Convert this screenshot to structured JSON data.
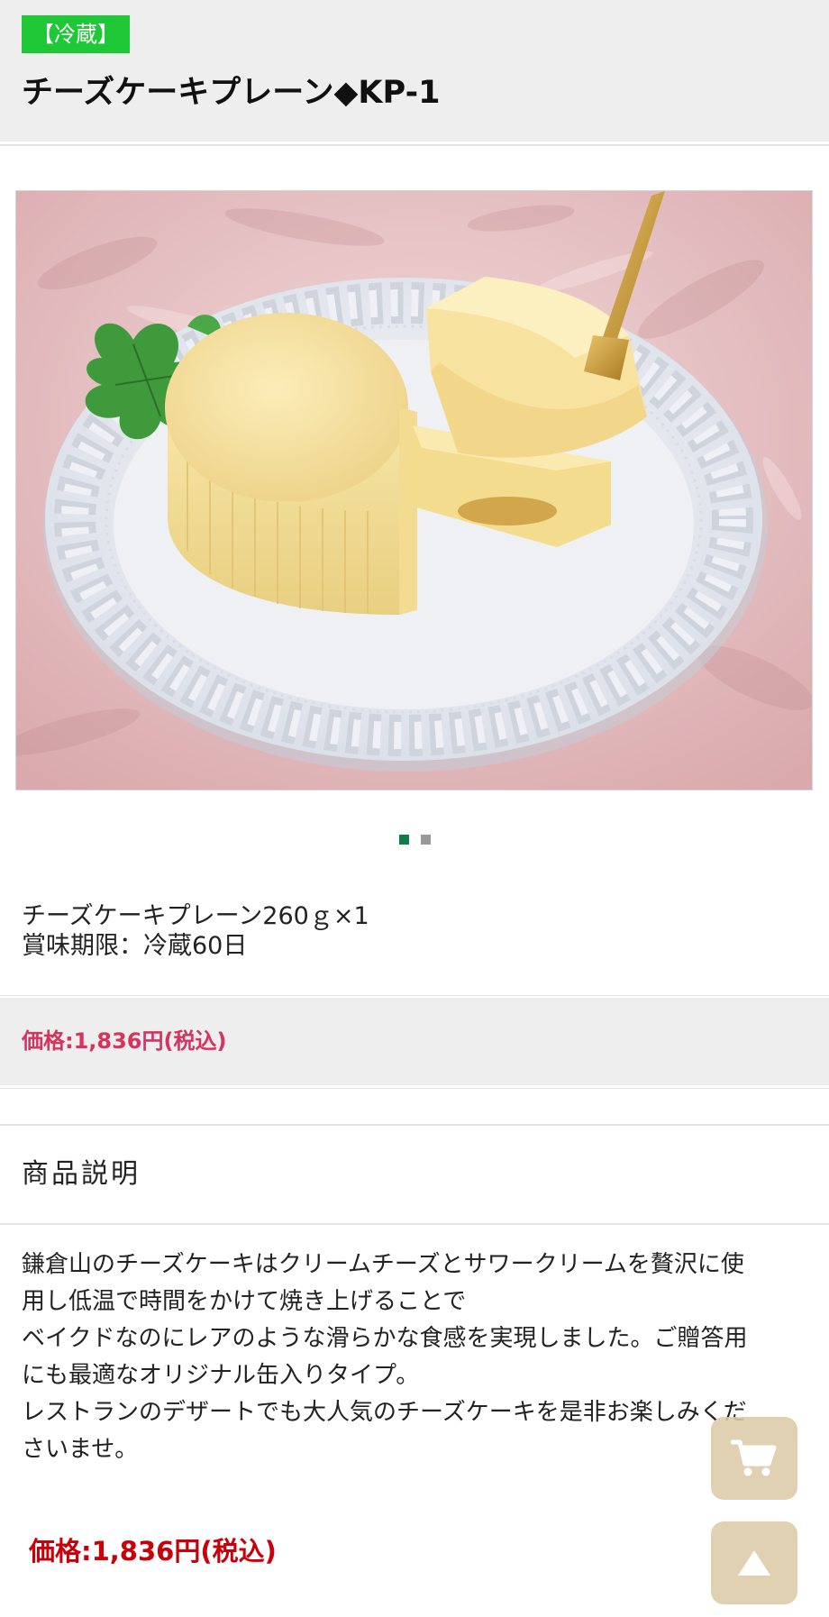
{
  "header": {
    "tag": "【冷蔵】",
    "title": "チーズケーキプレーン◆KP-1"
  },
  "gallery": {
    "image_name": "cheesecake-photo",
    "total_slides": 2,
    "active_slide": 1
  },
  "specs": {
    "line1": "チーズケーキプレーン260ｇ×1",
    "line2": "賞味期限：冷蔵60日"
  },
  "price_band": {
    "text": "価格:1,836円(税込)"
  },
  "description": {
    "heading": "商品説明",
    "lines": [
      "鎌倉山のチーズケーキはクリームチーズとサワークリームを贅沢に使",
      "用し低温で時間をかけて焼き上げることで",
      "ベイクドなのにレアのような滑らかな食感を実現しました。ご贈答用",
      "にも最適なオリジナル缶入りタイプ。",
      "レストランのデザートでも大人気のチーズケーキを是非お楽しみくだ",
      "さいませ。"
    ]
  },
  "price_bottom": {
    "text": "価格:1,836円(税込)"
  },
  "buttons": {
    "cart_icon": "cart-icon",
    "top_icon": "arrow-up-icon"
  },
  "colors": {
    "tag_bg": "#1ec837",
    "price_band_text": "#d6335e",
    "price_bottom_text": "#c8000a",
    "dot_active": "#0e7d4a",
    "dot_inactive": "#999999",
    "fab_bg": "#ddcba8"
  }
}
